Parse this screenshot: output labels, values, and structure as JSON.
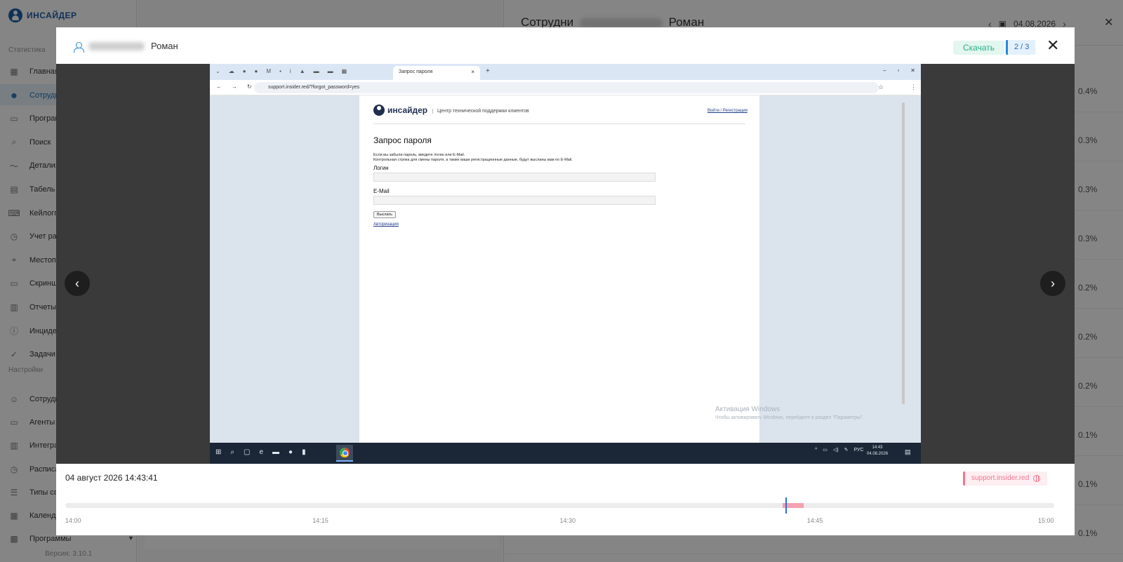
{
  "app": {
    "brand": "ИНСАЙДЕР",
    "sections": {
      "stats": "Статистика",
      "settings": "Настройки"
    },
    "nav_items": [
      {
        "label": "Главная",
        "icon": "dashboard-icon"
      },
      {
        "label": "Сотрудники",
        "icon": "people-icon",
        "active": true
      },
      {
        "label": "Программы",
        "icon": "window-icon"
      },
      {
        "label": "Поиск",
        "icon": "search-icon"
      },
      {
        "label": "Детализация",
        "icon": "trend-icon"
      },
      {
        "label": "Табель",
        "icon": "document-icon"
      },
      {
        "label": "Кейлоггер",
        "icon": "keyboard-icon"
      },
      {
        "label": "Учет рабочего времени",
        "icon": "clock-icon"
      },
      {
        "label": "Местоположение",
        "icon": "pin-icon"
      },
      {
        "label": "Скриншоты",
        "icon": "monitor-icon"
      },
      {
        "label": "Отчеты",
        "icon": "report-icon"
      },
      {
        "label": "Инциденты",
        "icon": "alert-icon"
      },
      {
        "label": "Задачи",
        "icon": "check-icon"
      }
    ],
    "settings_items": [
      {
        "label": "Сотрудники",
        "icon": "user-settings-icon"
      },
      {
        "label": "Агенты",
        "icon": "agent-icon"
      },
      {
        "label": "Интеграции",
        "icon": "building-icon"
      },
      {
        "label": "Расписание",
        "icon": "schedule-icon"
      },
      {
        "label": "Типы событий",
        "icon": "list-icon"
      },
      {
        "label": "Календарь",
        "icon": "calendar-icon"
      },
      {
        "label": "Программы",
        "icon": "apps-icon"
      }
    ],
    "version": "Версия: 3.10.1"
  },
  "right_panel": {
    "title_prefix": "Сотрудни",
    "title_suffix": "Роман",
    "date": "04.08.2026",
    "percentages": [
      "0.4%",
      "0.3%",
      "0.3%",
      "0.3%",
      "0.2%",
      "0.2%",
      "0.2%",
      "0.1%",
      "0.1%",
      "0.1%"
    ]
  },
  "modal": {
    "user_name": "Роман",
    "download_label": "Скачать",
    "counter": "2 / 3",
    "timestamp": "04 август 2026 14:43:41",
    "url_badge": "support.insider.red",
    "timeline": {
      "start": "14:00",
      "end": "15:00",
      "labels": [
        "14:00",
        "14:15",
        "14:30",
        "14:45",
        "15:00"
      ],
      "segment_start_min": 43.5,
      "segment_end_min": 44.8,
      "cursor_min": 43.7
    }
  },
  "screenshot": {
    "tab_title": "Запрос пароля",
    "url": "support.insider.red/?forgot_password=yes",
    "site_name": "инсайдер",
    "site_tagline": "Центр технической поддержки клиентов",
    "site_links": "Войти / Регистрация",
    "form_title": "Запрос пароля",
    "form_hint_1": "Если вы забыли пароль, введите логин или E-Mail.",
    "form_hint_2": "Контрольная строка для смены пароля, а также ваши регистрационные данные, будут высланы вам по E-Mail.",
    "login_label": "Логин",
    "email_label": "E-Mail",
    "submit_label": "Выслать",
    "auth_link": "Авторизация",
    "watermark_title": "Активация Windows",
    "watermark_text": "Чтобы активировать Windows, перейдите в раздел \"Параметры\".",
    "tray_lang": "РУС",
    "clock_time": "14:43",
    "clock_date": "04.08.2026"
  },
  "colors": {
    "accent": "#1f6fb8",
    "download_bg": "#e3f6ef",
    "url_badge": "#f2758f",
    "timeline_cursor": "#2a6fdb"
  }
}
